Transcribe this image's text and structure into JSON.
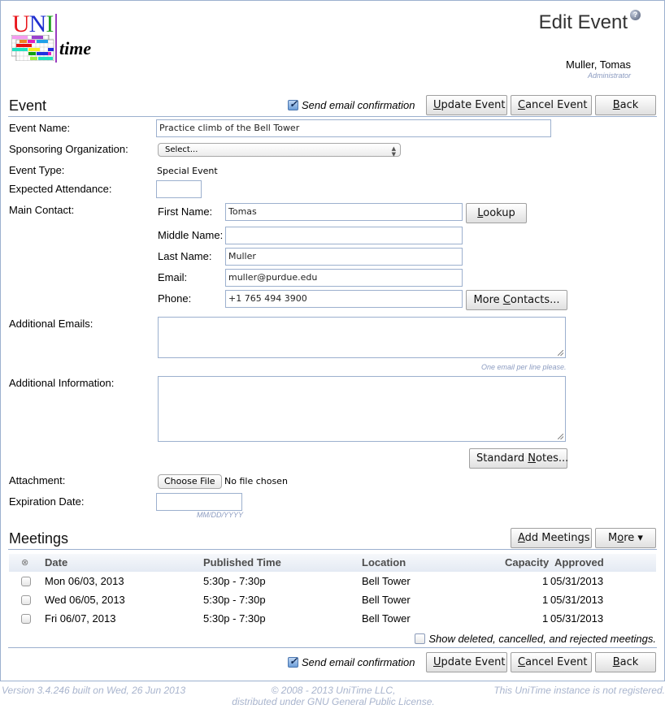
{
  "header": {
    "logo_text_uni": [
      "U",
      "N",
      "I"
    ],
    "logo_text_time": "time",
    "page_title": "Edit Event",
    "help_icon": "?",
    "user_name": "Muller, Tomas",
    "user_role": "Administrator"
  },
  "event_section": {
    "title": "Event",
    "send_email_label": "Send email confirmation",
    "send_email_checked": true,
    "buttons": {
      "update": {
        "prefix": "",
        "accel": "U",
        "suffix": "pdate Event"
      },
      "cancel": {
        "prefix": "",
        "accel": "C",
        "suffix": "ancel Event"
      },
      "back": {
        "prefix": "",
        "accel": "B",
        "suffix": "ack"
      }
    }
  },
  "form": {
    "event_name_label": "Event Name:",
    "event_name_value": "Practice climb of the Bell Tower",
    "sponsoring_org_label": "Sponsoring Organization:",
    "sponsoring_org_value": "Select...",
    "event_type_label": "Event Type:",
    "event_type_value": "Special Event",
    "expected_attendance_label": "Expected Attendance:",
    "expected_attendance_value": "",
    "main_contact_label": "Main Contact:",
    "contact": {
      "first_name_label": "First Name:",
      "first_name_value": "Tomas",
      "middle_name_label": "Middle Name:",
      "middle_name_value": "",
      "last_name_label": "Last Name:",
      "last_name_value": "Muller",
      "email_label": "Email:",
      "email_value": "muller@purdue.edu",
      "phone_label": "Phone:",
      "phone_value": "+1 765 494 3900",
      "lookup_button": {
        "prefix": "",
        "accel": "L",
        "suffix": "ookup"
      },
      "more_contacts_button": {
        "prefix": "More ",
        "accel": "C",
        "suffix": "ontacts..."
      }
    },
    "additional_emails_label": "Additional Emails:",
    "additional_emails_value": "",
    "additional_emails_hint": "One email per line please.",
    "additional_info_label": "Additional Information:",
    "additional_info_value": "",
    "standard_notes_button": {
      "prefix": "Standard ",
      "accel": "N",
      "suffix": "otes..."
    },
    "attachment_label": "Attachment:",
    "choose_file_button": "Choose File",
    "no_file_text": "No file chosen",
    "expiration_date_label": "Expiration Date:",
    "expiration_date_value": "",
    "expiration_date_hint": "MM/DD/YYYY"
  },
  "meetings_section": {
    "title": "Meetings",
    "add_meetings_button": {
      "prefix": "",
      "accel": "A",
      "suffix": "dd Meetings"
    },
    "more_button": {
      "prefix": "M",
      "accel": "o",
      "suffix": "re ▾"
    },
    "columns": [
      "Date",
      "Published Time",
      "Location",
      "Capacity",
      "Approved"
    ],
    "select_all_icon": "⊗",
    "rows": [
      {
        "date": "Mon 06/03, 2013",
        "time": "5:30p - 7:30p",
        "location": "Bell Tower",
        "capacity": "1",
        "approved": "05/31/2013"
      },
      {
        "date": "Wed 06/05, 2013",
        "time": "5:30p - 7:30p",
        "location": "Bell Tower",
        "capacity": "1",
        "approved": "05/31/2013"
      },
      {
        "date": "Fri 06/07, 2013",
        "time": "5:30p - 7:30p",
        "location": "Bell Tower",
        "capacity": "1",
        "approved": "05/31/2013"
      }
    ],
    "show_deleted_label": "Show deleted, cancelled, and rejected meetings.",
    "show_deleted_checked": false
  },
  "footer": {
    "version": "Version 3.4.246 built on Wed, 26 Jun 2013",
    "copyright_line1": "© 2008 - 2013 UniTime LLC,",
    "copyright_line2": "distributed under GNU General Public License.",
    "registration": "This UniTime instance is not registered."
  },
  "colors": {
    "border": "#9cb0ce",
    "hint_text": "#8b9bc0",
    "footer_text": "#a8b4cd"
  }
}
